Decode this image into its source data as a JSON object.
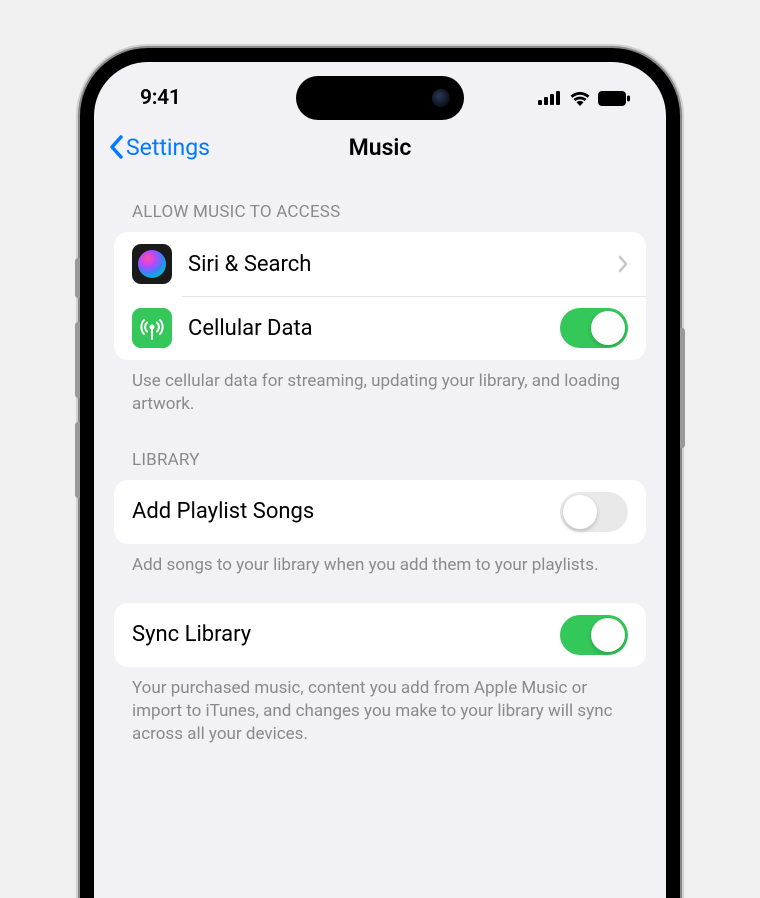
{
  "statusBar": {
    "time": "9:41"
  },
  "nav": {
    "back": "Settings",
    "title": "Music"
  },
  "sections": {
    "access": {
      "header": "ALLOW MUSIC TO ACCESS",
      "siri": "Siri & Search",
      "cellular": "Cellular Data",
      "cellularOn": true,
      "footer": "Use cellular data for streaming, updating your library, and loading artwork."
    },
    "library": {
      "header": "LIBRARY",
      "addPlaylist": "Add Playlist Songs",
      "addPlaylistOn": false,
      "addPlaylistFooter": "Add songs to your library when you add them to your playlists.",
      "sync": "Sync Library",
      "syncOn": true,
      "syncFooter": "Your purchased music, content you add from Apple Music or import to iTunes, and changes you make to your library will sync across all your devices."
    }
  }
}
